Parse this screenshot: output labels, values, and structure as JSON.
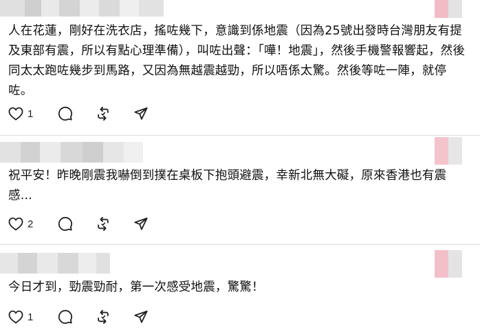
{
  "comments": [
    {
      "text": "人在花蓮，剛好在洗衣店，搖咗幾下，意識到係地震（因為25號出發時台灣朋友有提及東部有震，所以有點心理準備），叫咗出聲：「嘩！地震」，然後手機警報響起，然後同太太跑咗幾步到馬路，又因為無越震越勁，所以唔係太驚。然後等咗一陣，就停咗。",
      "likes": "1"
    },
    {
      "text": "祝平安！昨晚剛震我嚇倒到撲在桌板下抱頭避震，幸新北無大礙，原來香港也有震感...",
      "likes": "2"
    },
    {
      "text": "今日才到，勁震勁耐，第一次感受地震，驚驚！",
      "likes": "1"
    }
  ],
  "icons": {
    "like": "heart-icon",
    "reply": "speech-bubble-icon",
    "repost": "repost-icon",
    "share": "paper-plane-icon"
  },
  "colors": {
    "text": "#101010",
    "divider": "#dcdcdc",
    "avatar_pink": "#f2bcc7",
    "avatar_gray": "#e6e6e6",
    "username_blur": "#d6d6d6"
  }
}
